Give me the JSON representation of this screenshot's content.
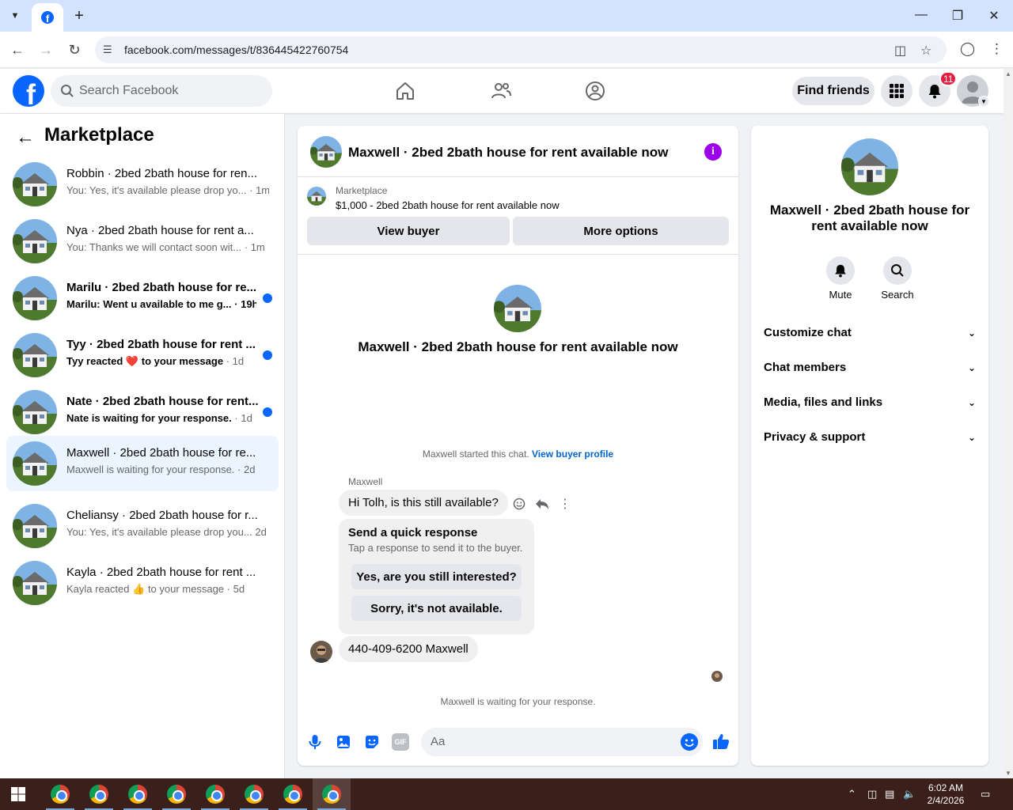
{
  "browser": {
    "url": "facebook.com/messages/t/836445422760754"
  },
  "header": {
    "search_placeholder": "Search Facebook",
    "find_friends": "Find friends",
    "notif_count": "11"
  },
  "sidebar": {
    "title": "Marketplace",
    "conversations": [
      {
        "name": "Robbin · 2bed 2bath house for ren...",
        "preview": "You: Yes, it's available please drop yo...",
        "time": "· 1m",
        "unread": false
      },
      {
        "name": "Nya · 2bed 2bath house for rent a...",
        "preview": "You: Thanks we will contact soon wit...",
        "time": "· 1m",
        "unread": false
      },
      {
        "name": "Marilu · 2bed 2bath house for re...",
        "preview": "Marilu: Went u available to me g...",
        "time": "· 19h",
        "unread": true
      },
      {
        "name": "Tyy · 2bed 2bath house for rent ...",
        "preview_before": "Tyy reacted",
        "preview_after": "to your message",
        "time": "· 1d",
        "unread": true
      },
      {
        "name": "Nate · 2bed 2bath house for rent...",
        "preview": "Nate is waiting for your response.",
        "time": "· 1d",
        "unread": true
      },
      {
        "name": "Maxwell · 2bed 2bath house for re...",
        "preview": "Maxwell is waiting for your response.",
        "time": "· 2d",
        "unread": false
      },
      {
        "name": "Cheliansy · 2bed 2bath house for r...",
        "preview": "You: Yes, it's available please drop you...",
        "time": "2d",
        "unread": false
      },
      {
        "name": "Kayla · 2bed 2bath house for rent ...",
        "preview_before": "Kayla reacted",
        "preview_after": "to your message",
        "time": "· 5d",
        "unread": false
      }
    ]
  },
  "chat": {
    "title": "Maxwell · 2bed 2bath house for rent available now",
    "marketplace_label": "Marketplace",
    "listing": "$1,000 - 2bed 2bath house for rent available now",
    "view_buyer": "View buyer",
    "more_options": "More options",
    "intro_title": "Maxwell · 2bed 2bath house for rent available now",
    "started_text": "Maxwell started this chat.",
    "view_buyer_profile": "View buyer profile",
    "sender": "Maxwell",
    "message1": "Hi Tolh, is this still available?",
    "quick_title": "Send a quick response",
    "quick_sub": "Tap a response to send it to the buyer.",
    "quick_reply1": "Yes, are you still interested?",
    "quick_reply2": "Sorry, it's not available.",
    "message2": "440-409-6200 Maxwell",
    "waiting": "Maxwell is waiting for your response.",
    "composer_placeholder": "Aa"
  },
  "right_panel": {
    "title": "Maxwell · 2bed 2bath house for rent available now",
    "mute": "Mute",
    "search": "Search",
    "sections": [
      "Customize chat",
      "Chat members",
      "Media, files and links",
      "Privacy & support"
    ]
  },
  "taskbar": {
    "time": "6:02 AM",
    "date": "2/4/2026"
  }
}
